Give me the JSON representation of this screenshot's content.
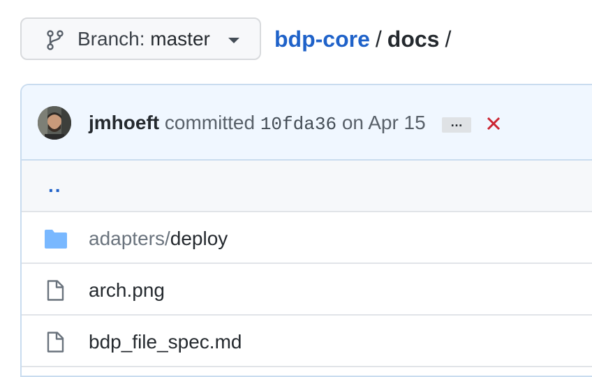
{
  "branch": {
    "prefix": "Branch: ",
    "name": "master"
  },
  "breadcrumb": {
    "repo": "bdp-core",
    "sep1": "/",
    "dir": "docs",
    "sep2": "/"
  },
  "commit": {
    "author": "jmhoeft",
    "verb": "committed",
    "sha": "10fda36",
    "date": "on Apr 15",
    "ellipsis": "…",
    "status_color": "#cb2431"
  },
  "files": {
    "up": "..",
    "items": [
      {
        "type": "folder",
        "prefix": "adapters/",
        "name": "deploy"
      },
      {
        "type": "file",
        "prefix": "",
        "name": "arch.png"
      },
      {
        "type": "file",
        "prefix": "",
        "name": "bdp_file_spec.md"
      }
    ]
  },
  "colors": {
    "link": "#1f62c9",
    "folder": "#79b8ff",
    "commit_bg": "#f0f7ff"
  }
}
